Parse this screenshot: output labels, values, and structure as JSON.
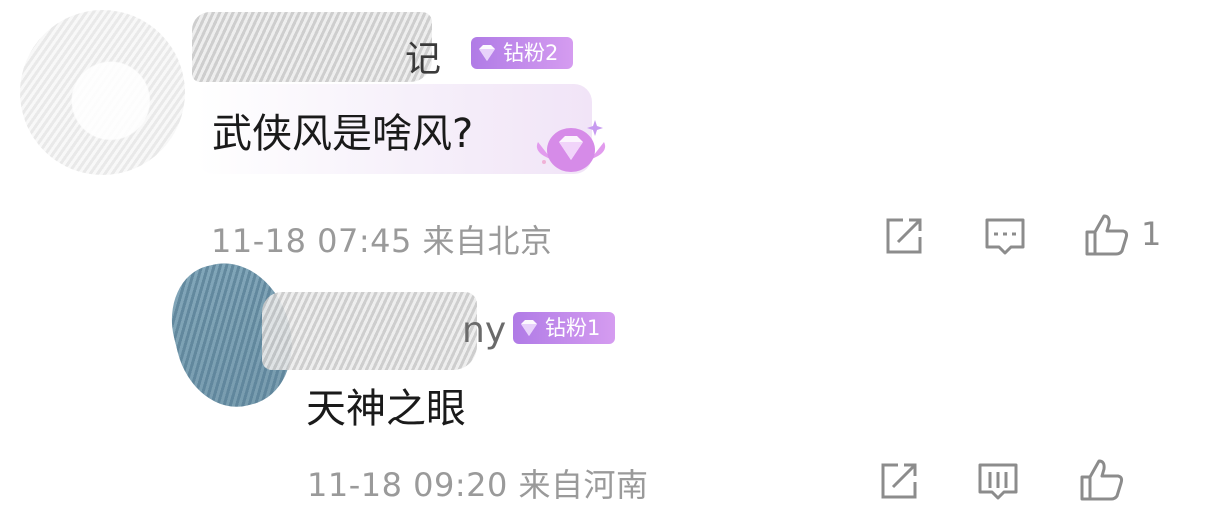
{
  "comments": [
    {
      "username_visible": "记",
      "badge": "钻粉2",
      "text": "武侠风是啥风?",
      "meta": "11-18 07:45 来自北京",
      "likes": "1"
    },
    {
      "username_visible": "ny",
      "badge": "钻粉1",
      "text": "天神之眼",
      "meta": "11-18 09:20 来自河南",
      "likes": ""
    }
  ],
  "icons": {
    "share": "share-icon",
    "comment": "comment-icon",
    "like": "thumbs-up-icon",
    "badge": "diamond-icon"
  },
  "colors": {
    "badge_start": "#b07be6",
    "badge_end": "#d59cf0",
    "meta_text": "#9a9a9a",
    "icon": "#8c8c8c"
  }
}
